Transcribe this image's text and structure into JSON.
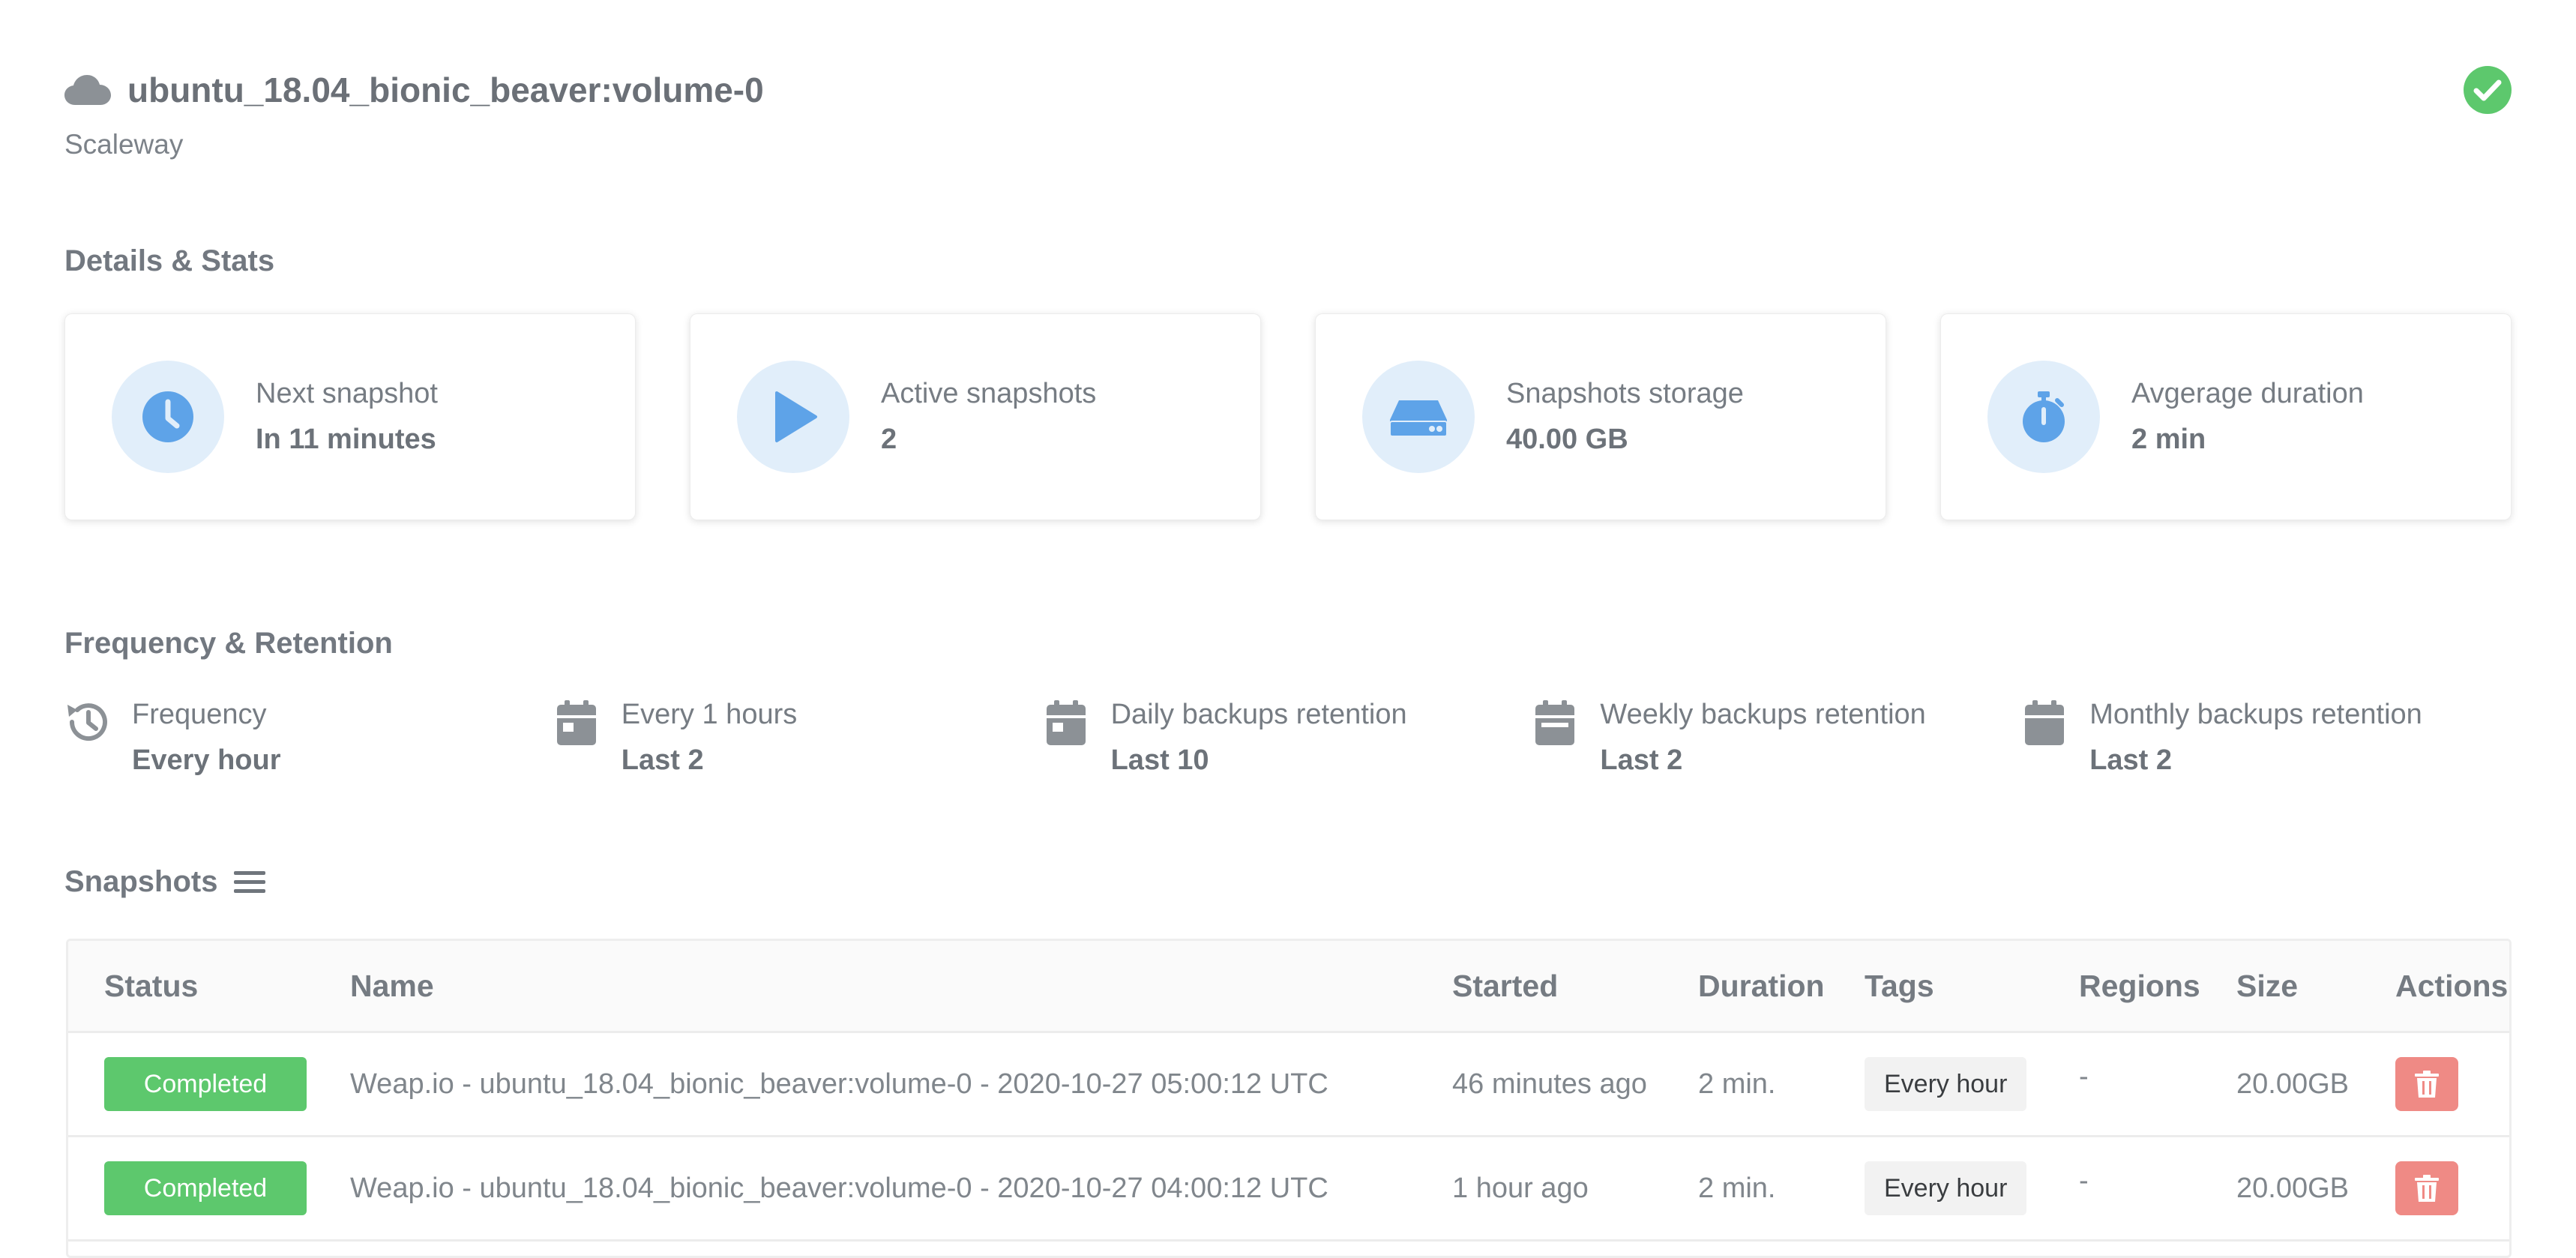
{
  "header": {
    "title": "ubuntu_18.04_bionic_beaver:volume-0",
    "provider": "Scaleway",
    "status_color": "#5dc86d"
  },
  "sections": {
    "details": "Details & Stats",
    "frequency": "Frequency & Retention",
    "snapshots": "Snapshots"
  },
  "stats": [
    {
      "icon": "clock-icon",
      "label": "Next snapshot",
      "value": "In 11 minutes"
    },
    {
      "icon": "play-icon",
      "label": "Active snapshots",
      "value": "2"
    },
    {
      "icon": "hard-drive-icon",
      "label": "Snapshots storage",
      "value": "40.00 GB"
    },
    {
      "icon": "stopwatch-icon",
      "label": "Avgerage duration",
      "value": "2 min"
    }
  ],
  "frequency": [
    {
      "icon": "history-icon",
      "label": "Frequency",
      "value": "Every hour"
    },
    {
      "icon": "calendar-icon",
      "label": "Every 1 hours",
      "value": "Last 2"
    },
    {
      "icon": "calendar-icon",
      "label": "Daily backups retention",
      "value": "Last 10"
    },
    {
      "icon": "calendar-icon",
      "label": "Weekly backups retention",
      "value": "Last 2"
    },
    {
      "icon": "calendar-icon",
      "label": "Monthly backups retention",
      "value": "Last 2"
    }
  ],
  "table": {
    "columns": [
      "Status",
      "Name",
      "Started",
      "Duration",
      "Tags",
      "Regions",
      "Size",
      "Actions"
    ],
    "rows": [
      {
        "status": "Completed",
        "name": "Weap.io - ubuntu_18.04_bionic_beaver:volume-0 - 2020-10-27 05:00:12 UTC",
        "started": "46 minutes ago",
        "duration": "2 min.",
        "tag": "Every hour",
        "regions": "-",
        "size": "20.00GB"
      },
      {
        "status": "Completed",
        "name": "Weap.io - ubuntu_18.04_bionic_beaver:volume-0 - 2020-10-27 04:00:12 UTC",
        "started": "1 hour ago",
        "duration": "2 min.",
        "tag": "Every hour",
        "regions": "-",
        "size": "20.00GB"
      }
    ]
  },
  "colors": {
    "accent": "#5ea3e8",
    "success": "#5dc86d",
    "danger": "#ef8a85",
    "icon_gray": "#8c9196"
  }
}
